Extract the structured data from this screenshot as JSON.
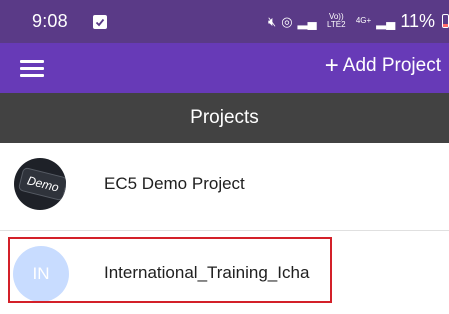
{
  "status_bar": {
    "time": "9:08",
    "volte_label": "Vo)) LTE2",
    "network_label": "4G+",
    "battery": "11%",
    "icons": [
      "gallery-check-icon",
      "mute-icon",
      "hotspot-icon",
      "signal-icon",
      "signal-icon",
      "battery-icon"
    ]
  },
  "toolbar": {
    "menu_icon": "menu-icon",
    "add_project_label": "Add Project",
    "add_project_icon": "plus-icon"
  },
  "header": {
    "title": "Projects"
  },
  "projects": [
    {
      "name": "EC5 Demo Project",
      "avatar_text": "Demo"
    },
    {
      "name": "International_Training_Icha",
      "avatar_text": "IN"
    }
  ],
  "colors": {
    "status_bar": "#5a3a87",
    "toolbar": "#673ab7",
    "header_band": "#424242",
    "highlight_border": "#d32029",
    "avatar_in_bg": "#c8dcff"
  }
}
